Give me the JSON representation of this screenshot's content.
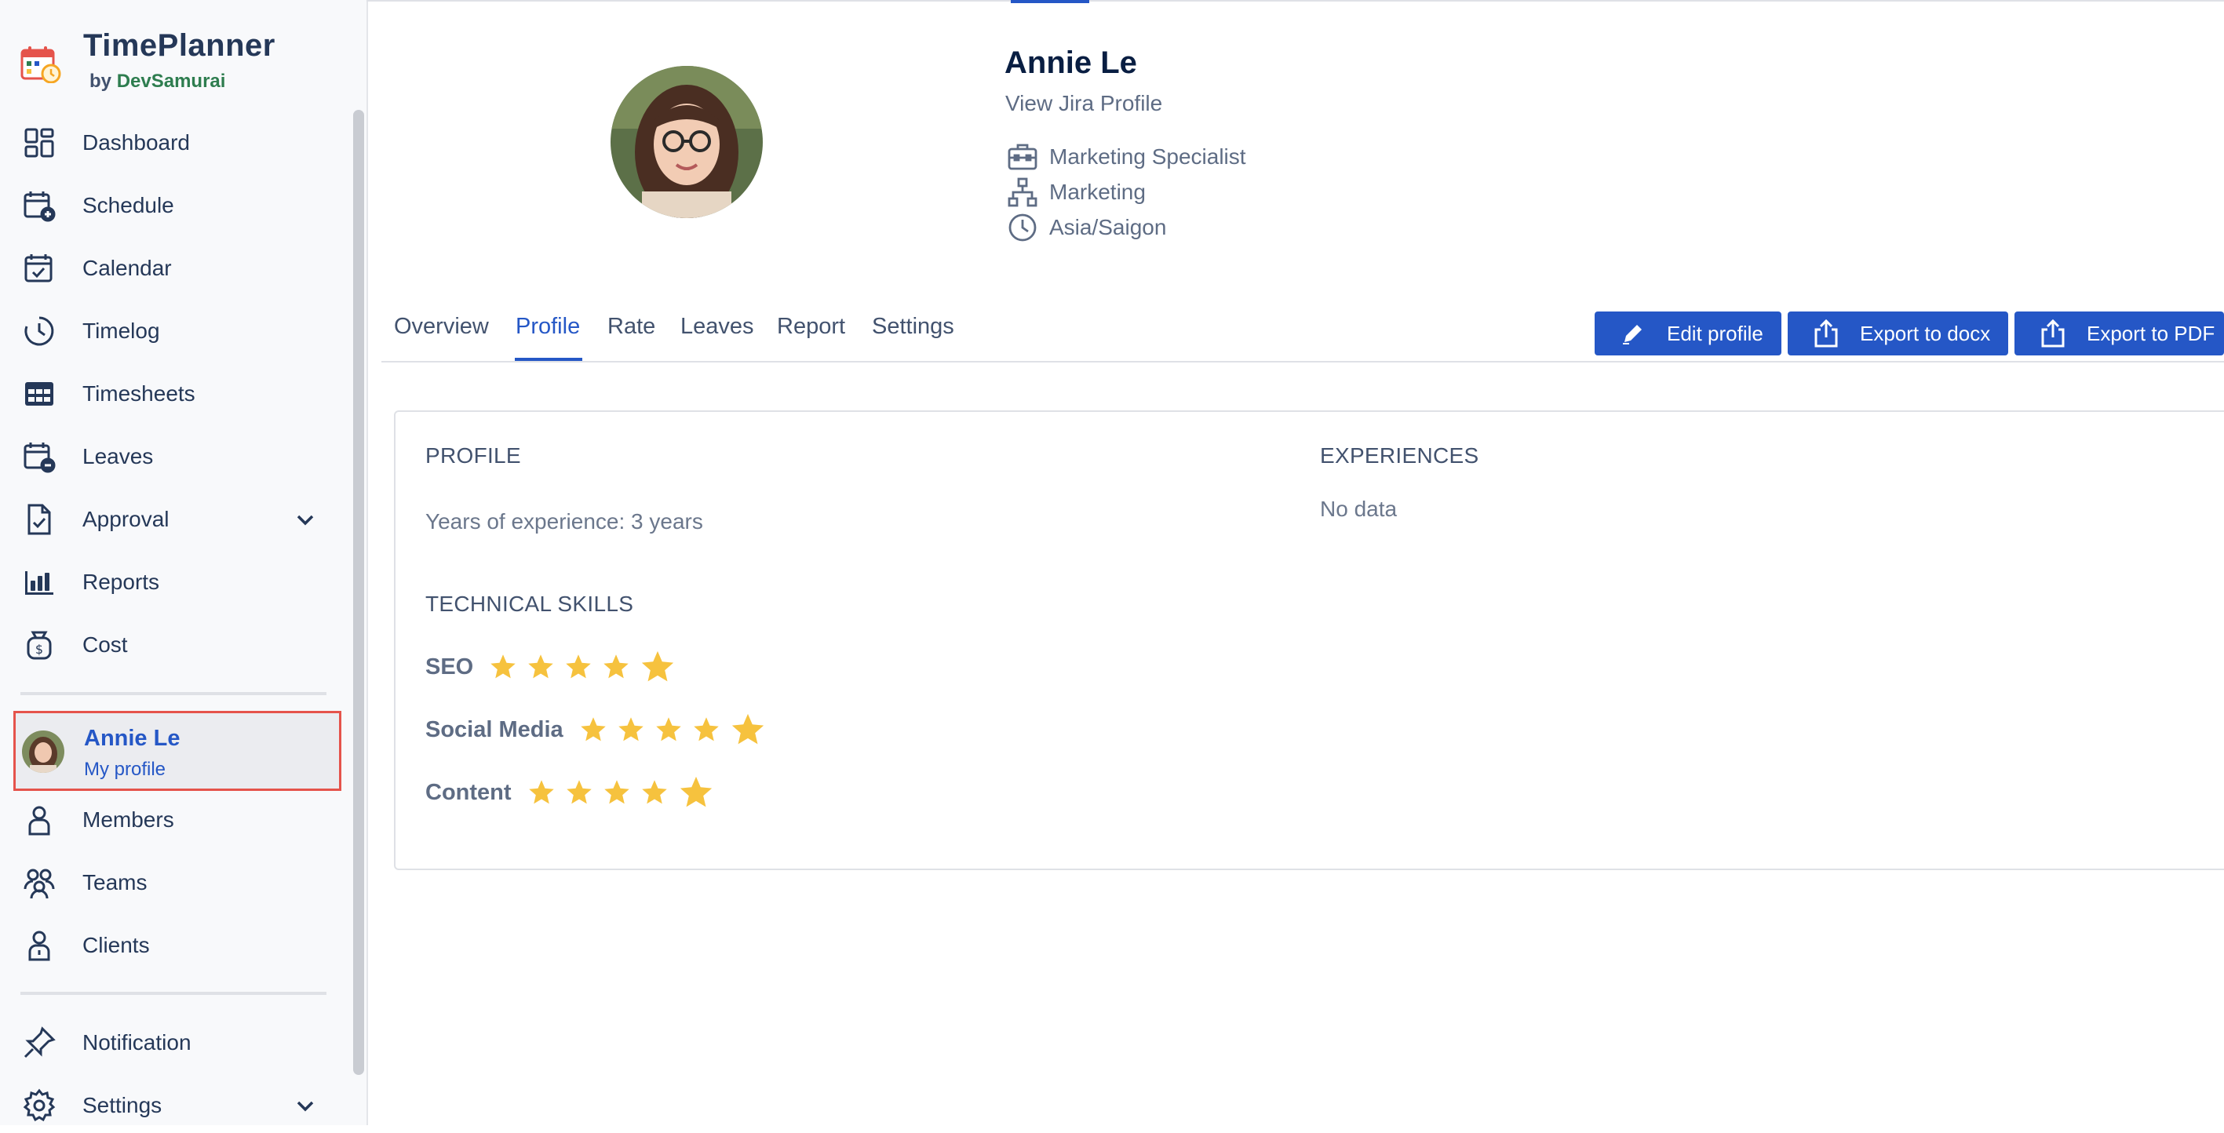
{
  "app": {
    "name": "TimePlanner",
    "by": "by",
    "vendor": "DevSamurai"
  },
  "sidebar": {
    "items": [
      {
        "label": "Dashboard",
        "icon": "dashboard-icon"
      },
      {
        "label": "Schedule",
        "icon": "calendar-plus-icon"
      },
      {
        "label": "Calendar",
        "icon": "calendar-check-icon"
      },
      {
        "label": "Timelog",
        "icon": "clock-icon"
      },
      {
        "label": "Timesheets",
        "icon": "table-icon"
      },
      {
        "label": "Leaves",
        "icon": "calendar-minus-icon"
      },
      {
        "label": "Approval",
        "icon": "document-check-icon"
      },
      {
        "label": "Reports",
        "icon": "bar-chart-icon"
      },
      {
        "label": "Cost",
        "icon": "money-bag-icon"
      }
    ],
    "profile": {
      "name": "Annie Le",
      "subtitle": "My profile"
    },
    "items2": [
      {
        "label": "Members",
        "icon": "user-icon"
      },
      {
        "label": "Teams",
        "icon": "team-icon"
      },
      {
        "label": "Clients",
        "icon": "client-icon"
      }
    ],
    "items3": [
      {
        "label": "Notification",
        "icon": "pin-icon"
      },
      {
        "label": "Settings",
        "icon": "gear-icon"
      }
    ]
  },
  "user": {
    "name": "Annie Le",
    "jira_link": "View Jira Profile",
    "title": "Marketing Specialist",
    "department": "Marketing",
    "timezone": "Asia/Saigon"
  },
  "tabs": [
    "Overview",
    "Profile",
    "Rate",
    "Leaves",
    "Report",
    "Settings"
  ],
  "active_tab": "Profile",
  "buttons": {
    "edit": "Edit profile",
    "export_docx": "Export to docx",
    "export_pdf": "Export to PDF"
  },
  "profile_section": {
    "title": "PROFILE",
    "experience": "Years of experience: 3 years",
    "skills_title": "TECHNICAL SKILLS",
    "skills": [
      {
        "name": "SEO",
        "rating": 5,
        "max": 5
      },
      {
        "name": "Social Media",
        "rating": 5,
        "max": 5
      },
      {
        "name": "Content",
        "rating": 5,
        "max": 5
      }
    ]
  },
  "experiences_section": {
    "title": "EXPERIENCES",
    "empty": "No data"
  },
  "colors": {
    "accent": "#2557c6",
    "star": "#f6c23e",
    "highlight_border": "#e5534b"
  }
}
